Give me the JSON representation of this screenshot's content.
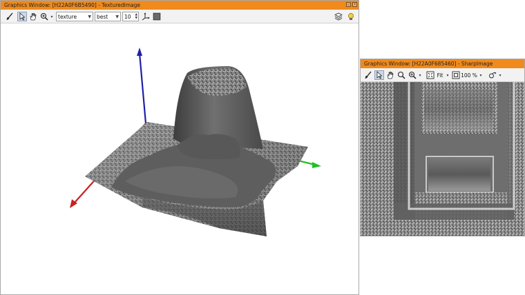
{
  "window_left": {
    "title": "Graphics Window: [H22A0F6B5490] - TexturedImage",
    "toolbar": {
      "render_mode": "texture",
      "quality": "best",
      "sampling": "10"
    },
    "icons": [
      "brush-icon",
      "pointer-icon",
      "hand-icon",
      "zoom-icon",
      "axes-icon",
      "color-square-icon",
      "layers-icon",
      "bulb-icon"
    ]
  },
  "window_right": {
    "title": "Graphics Window: [H22A0F685460] - SharpImage",
    "toolbar": {
      "fit_label": "Fit",
      "zoom_label": "100 %"
    },
    "icons": [
      "brush-icon",
      "pointer-icon",
      "hand-icon",
      "magnifier-icon",
      "zoom-in-icon",
      "fit-icon",
      "zoom-percent-icon",
      "rotate-icon"
    ]
  },
  "colors": {
    "titlebar": "#f08a1c",
    "axis_x": "#cc1f1f",
    "axis_y": "#1fbf2a",
    "axis_z": "#1f1fa8"
  }
}
